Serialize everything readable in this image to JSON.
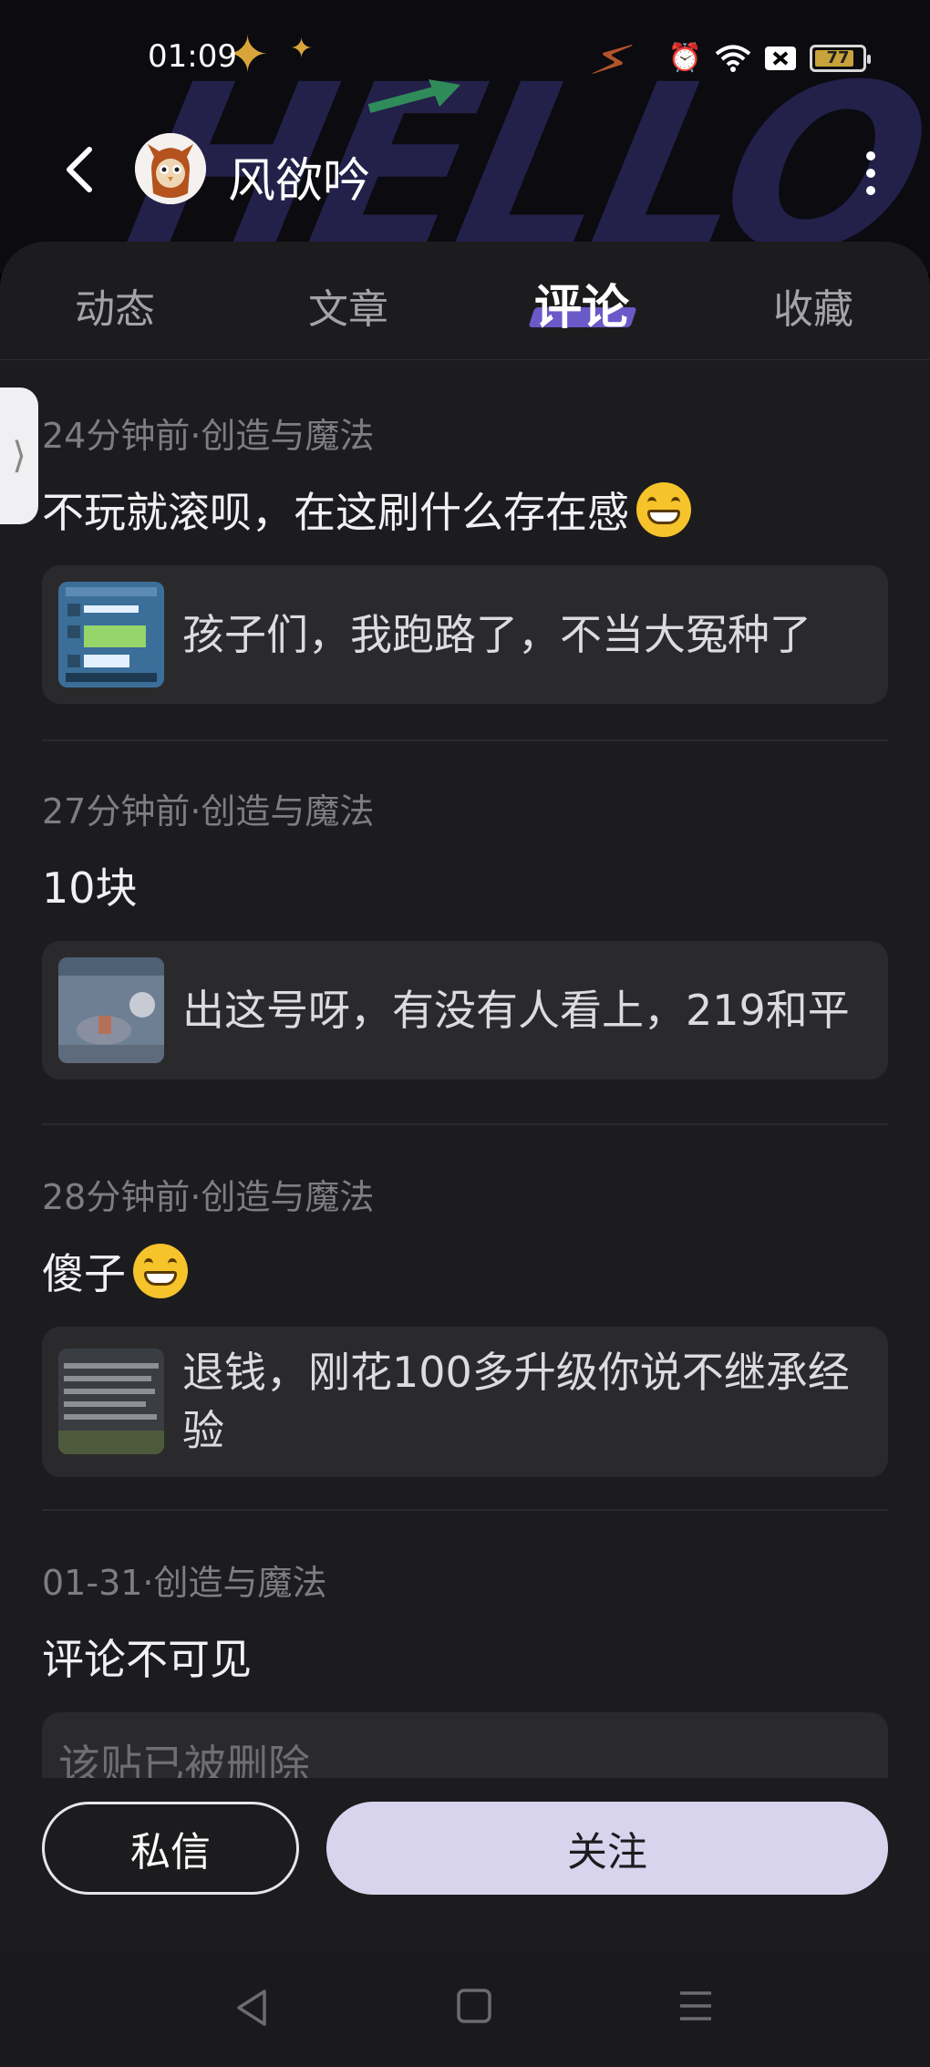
{
  "status_bar": {
    "time": "01:09",
    "battery": "77"
  },
  "header": {
    "username": "风欲吟",
    "banner_text": "HELLO"
  },
  "tabs": [
    {
      "label": "动态"
    },
    {
      "label": "文章"
    },
    {
      "label": "评论"
    },
    {
      "label": "收藏"
    }
  ],
  "active_tab": "评论",
  "comments": [
    {
      "meta": "24分钟前·创造与魔法",
      "text": "不玩就滚呗，在这刷什么存在感",
      "emoji": "grinning-face",
      "post": "孩子们，我跑路了，不当大冤种了"
    },
    {
      "meta": "27分钟前·创造与魔法",
      "text": "10块",
      "post": "出这号呀，有没有人看上，219和平"
    },
    {
      "meta": "28分钟前·创造与魔法",
      "text": "傻子",
      "emoji": "grinning-face",
      "post": "退钱，刚花100多升级你说不继承经验"
    },
    {
      "meta": "01-31·创造与魔法",
      "text": "评论不可见",
      "post": "该贴已被删除"
    }
  ],
  "actions": {
    "message": "私信",
    "follow": "关注"
  },
  "colors": {
    "accent": "#6a59c8",
    "follow_bg": "#d9d4ee",
    "panel_bg": "#1c1c1e",
    "card_bg": "#2a2a2c"
  }
}
